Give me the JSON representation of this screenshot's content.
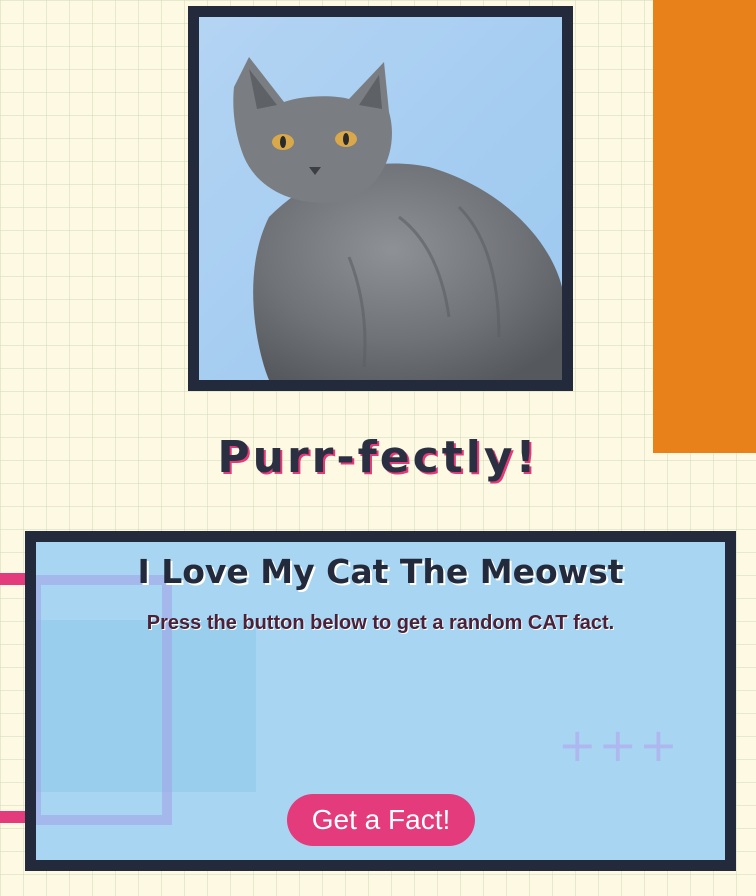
{
  "hero": {
    "tagline": "Purr-fectly!"
  },
  "card": {
    "title": "I Love My Cat The Meowst",
    "subtitle": "Press the button below to get a random CAT fact.",
    "decoration": "+++",
    "button_label": "Get a Fact!"
  },
  "colors": {
    "background": "#fdf9e3",
    "accent_orange": "#e8811a",
    "frame_navy": "#232a3c",
    "card_blue": "#a8d5f2",
    "accent_pink": "#e33b7c"
  },
  "icons": {
    "photo": "gray-cat-photo"
  }
}
